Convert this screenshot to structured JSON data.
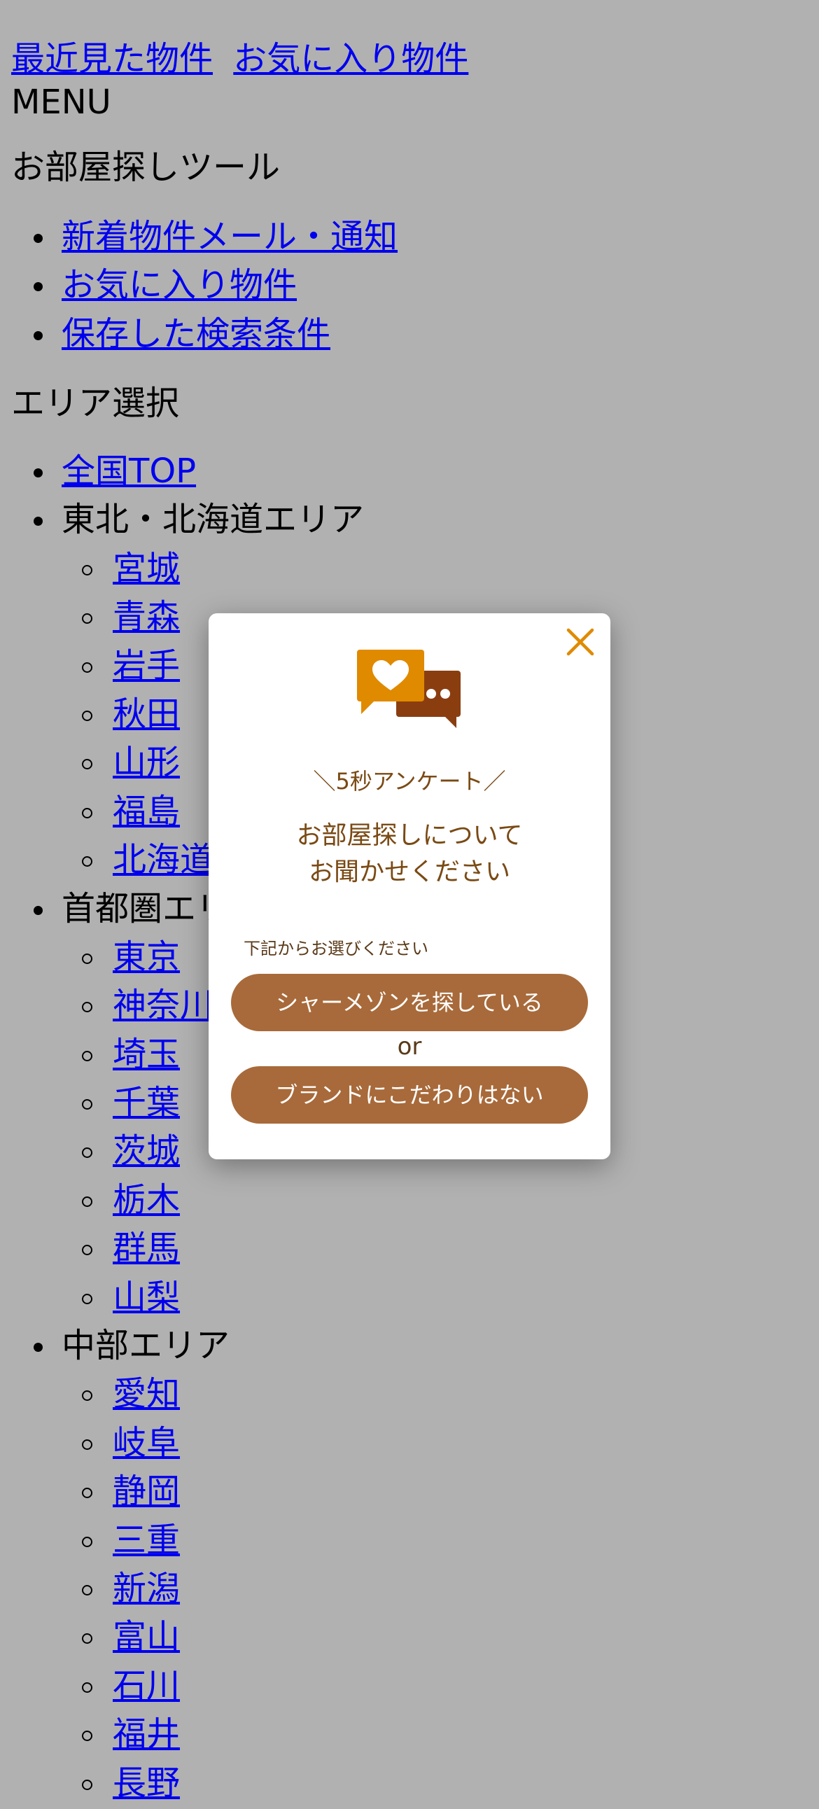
{
  "header": {
    "recent_link": "最近見た物件",
    "favorites_link": "お気に入り物件",
    "menu_label": "MENU"
  },
  "tools": {
    "title": "お部屋探しツール",
    "items": [
      "新着物件メール・通知",
      "お気に入り物件",
      "保存した検索条件"
    ]
  },
  "area": {
    "title": "エリア選択",
    "top_link": "全国TOP",
    "groups": [
      {
        "label": "東北・北海道エリア",
        "items": [
          "宮城",
          "青森",
          "岩手",
          "秋田",
          "山形",
          "福島",
          "北海道"
        ]
      },
      {
        "label": "首都圏エリア",
        "items": [
          "東京",
          "神奈川",
          "埼玉",
          "千葉",
          "茨城",
          "栃木",
          "群馬",
          "山梨"
        ]
      },
      {
        "label": "中部エリア",
        "items": [
          "愛知",
          "岐阜",
          "静岡",
          "三重",
          "新潟",
          "富山",
          "石川",
          "福井",
          "長野"
        ]
      }
    ]
  },
  "modal": {
    "survey_label": "＼5秒アンケート／",
    "title_line1": "お部屋探しについて",
    "title_line2": "お聞かせください",
    "choose_label": "下記からお選びください",
    "option1": "シャーメゾンを探している",
    "or_label": "or",
    "option2": "ブランドにこだわりはない",
    "icon": "chat-heart-icon",
    "close_icon": "close-icon"
  },
  "colors": {
    "overlay": "#b1b1b1",
    "accent": "#e08a00",
    "button": "#a86a3a",
    "title_text": "#7a4a14"
  }
}
